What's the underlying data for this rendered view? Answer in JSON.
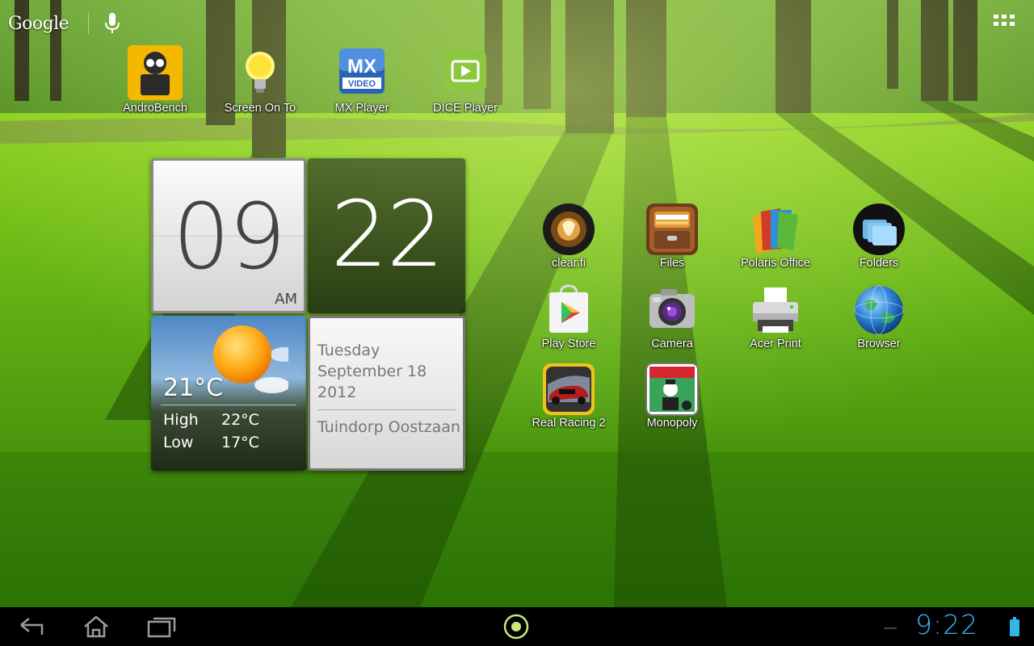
{
  "top_bar": {
    "search_logo": "Google",
    "mic_icon": "mic-icon",
    "apps_icon": "all-apps-grid-icon"
  },
  "top_shortcuts": [
    {
      "label": "AndroBench",
      "icon": "androbench-icon"
    },
    {
      "label": "Screen On To",
      "icon": "lightbulb-icon"
    },
    {
      "label": "MX Player",
      "icon": "mx-player-icon"
    },
    {
      "label": "DICE Player",
      "icon": "dice-player-icon"
    }
  ],
  "clock_widget": {
    "hours": "09",
    "minutes": "22",
    "ampm": "AM",
    "weather": {
      "current_temp": "21°C",
      "high_label": "High",
      "high_value": "22°C",
      "low_label": "Low",
      "low_value": "17°C"
    },
    "date": {
      "weekday": "Tuesday",
      "month_day": "September 18",
      "year": "2012",
      "location": "Tuindorp Oostzaan"
    }
  },
  "app_grid": [
    {
      "label": "clear.fi",
      "icon": "clearfi-icon"
    },
    {
      "label": "Files",
      "icon": "files-icon"
    },
    {
      "label": "Polaris Office",
      "icon": "polaris-office-icon"
    },
    {
      "label": "Folders",
      "icon": "folders-icon"
    },
    {
      "label": "Play Store",
      "icon": "play-store-icon"
    },
    {
      "label": "Camera",
      "icon": "camera-icon"
    },
    {
      "label": "Acer Print",
      "icon": "printer-icon"
    },
    {
      "label": "Browser",
      "icon": "globe-icon"
    },
    {
      "label": "Real Racing 2",
      "icon": "racing-car-icon"
    },
    {
      "label": "Monopoly",
      "icon": "monopoly-icon"
    }
  ],
  "system_bar": {
    "back_icon": "back-icon",
    "home_icon": "home-icon",
    "recents_icon": "recent-apps-icon",
    "center_icon": "lens-icon",
    "time": "9:22",
    "battery_icon": "battery-icon",
    "accent_color": "#33b5e5"
  }
}
